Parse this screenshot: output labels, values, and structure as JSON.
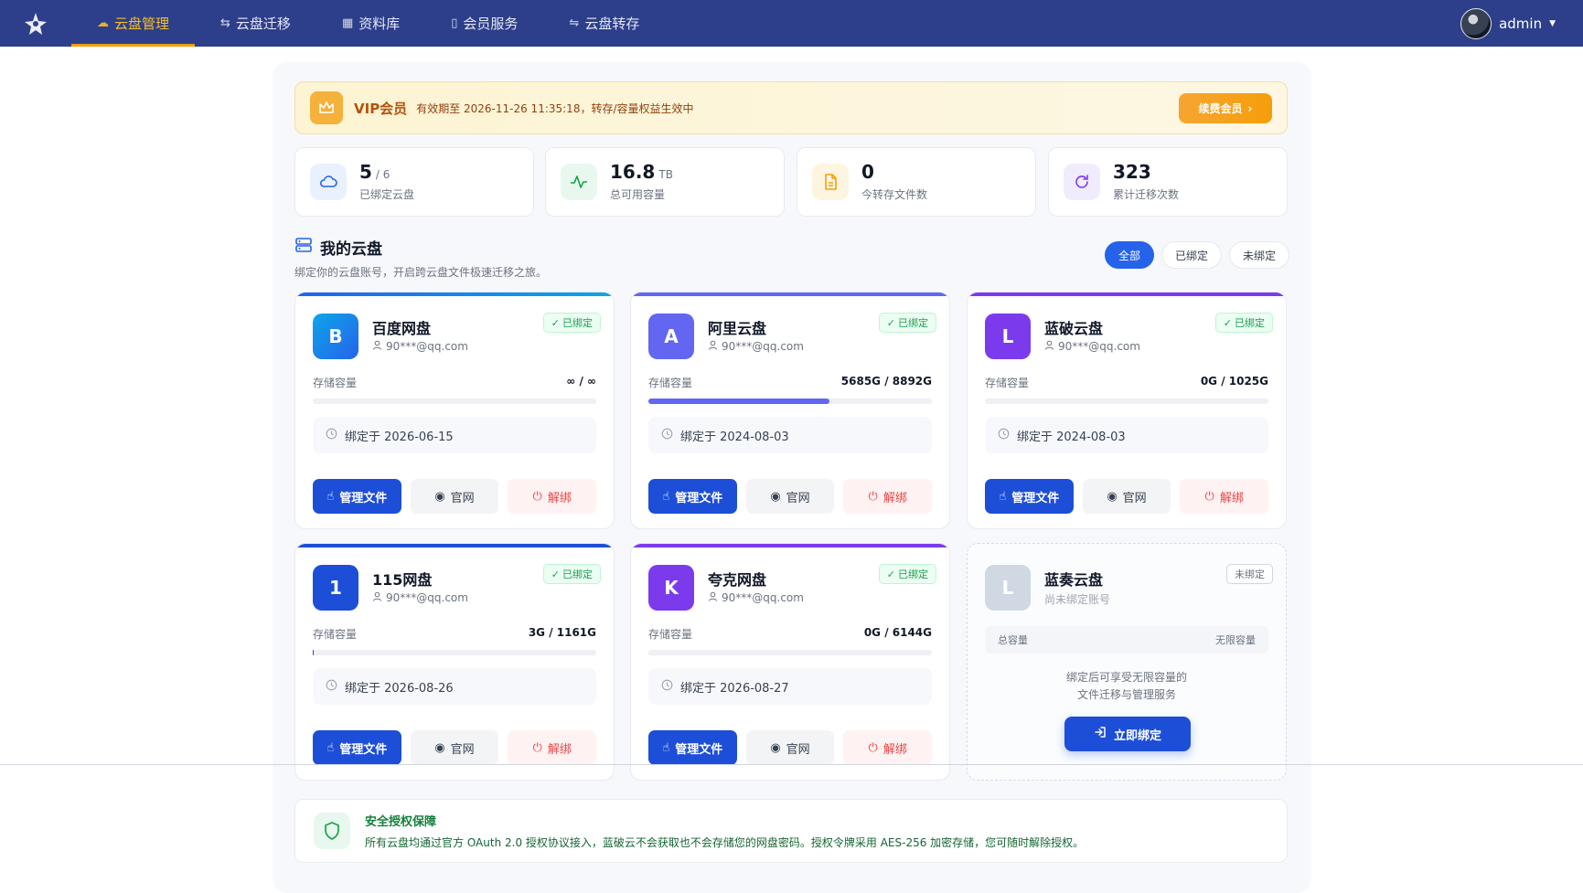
{
  "nav": {
    "items": [
      {
        "label": "云盘管理",
        "icon": "cloud-icon",
        "active": true
      },
      {
        "label": "云盘迁移",
        "icon": "transfer-icon",
        "active": false
      },
      {
        "label": "资料库",
        "icon": "grid-icon",
        "active": false
      },
      {
        "label": "会员服务",
        "icon": "bookmark-icon",
        "active": false
      },
      {
        "label": "云盘转存",
        "icon": "swap-icon",
        "active": false
      }
    ],
    "user": "admin"
  },
  "vip": {
    "title": "VIP会员",
    "text": "有效期至 2026-11-26 11:35:18，转存/容量权益生效中",
    "button": "续费会员"
  },
  "stats": [
    {
      "value": "5",
      "unit": "/ 6",
      "label": "已绑定云盘",
      "color": "#2563eb"
    },
    {
      "value": "16.8",
      "unit": "TB",
      "label": "总可用容量",
      "color": "#16a34a"
    },
    {
      "value": "0",
      "unit": "",
      "label": "今转存文件数",
      "color": "#f59e0b"
    },
    {
      "value": "323",
      "unit": "",
      "label": "累计迁移次数",
      "color": "#7c3aed"
    }
  ],
  "section": {
    "title": "我的云盘",
    "subtitle": "绑定你的云盘账号，开启跨云盘文件极速迁移之旅。",
    "filters": [
      "全部",
      "已绑定",
      "未绑定"
    ],
    "active_filter": 0
  },
  "cards": [
    {
      "letter": "B",
      "name": "百度网盘",
      "account": "90***@qq.com",
      "status": "已绑定",
      "cap_label": "存储容量",
      "capacity": "∞ / ∞",
      "usage": 0,
      "date": "绑定于 2026-06-15",
      "color": "#0ea5e9",
      "bar": "#2563eb"
    },
    {
      "letter": "A",
      "name": "阿里云盘",
      "account": "90***@qq.com",
      "status": "已绑定",
      "cap_label": "存储容量",
      "capacity": "5685G / 8892G",
      "usage": 0.64,
      "date": "绑定于 2024-08-03",
      "color": "#6366f1",
      "bar": "#6366f1"
    },
    {
      "letter": "L",
      "name": "蓝破云盘",
      "account": "90***@qq.com",
      "status": "已绑定",
      "cap_label": "存储容量",
      "capacity": "0G / 1025G",
      "usage": 0,
      "date": "绑定于 2024-08-03",
      "color": "#7c3aed",
      "bar": "#7c3aed"
    },
    {
      "letter": "1",
      "name": "115网盘",
      "account": "90***@qq.com",
      "status": "已绑定",
      "cap_label": "存储容量",
      "capacity": "3G / 1161G",
      "usage": 0.003,
      "date": "绑定于 2026-08-26",
      "color": "#1d4ed8",
      "bar": "#1d4ed8"
    },
    {
      "letter": "K",
      "name": "夸克网盘",
      "account": "90***@qq.com",
      "status": "已绑定",
      "cap_label": "存储容量",
      "capacity": "0G / 6144G",
      "usage": 0,
      "date": "绑定于 2026-08-27",
      "color": "#7c3aed",
      "bar": "#7c3aed"
    }
  ],
  "card_actions": {
    "manage": "管理文件",
    "site": "官网",
    "unbind": "解绑"
  },
  "empty_card": {
    "letter": "L",
    "name": "蓝奏云盘",
    "account": "尚未绑定账号",
    "status": "未绑定",
    "cap_label": "总容量",
    "cap_value": "无限容量",
    "tip_line1": "绑定后可享受无限容量的",
    "tip_line2": "文件迁移与管理服务",
    "button": "立即绑定"
  },
  "security": {
    "title": "安全授权保障",
    "text": "所有云盘均通过官方 OAuth 2.0 授权协议接入，蓝破云不会获取也不会存储您的网盘密码。授权令牌采用 AES-256 加密存储，您可随时解除授权。"
  }
}
